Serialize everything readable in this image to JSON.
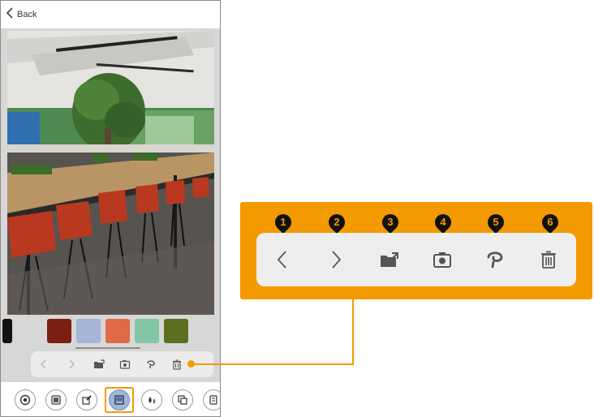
{
  "header": {
    "back_label": "Back",
    "back_icon": "chevron-left-icon"
  },
  "photo": {
    "subject": "office-interior-photo"
  },
  "swatches": [
    {
      "name": "black",
      "color": "#111111"
    },
    {
      "name": "rust-red",
      "color": "#7b1f12"
    },
    {
      "name": "periwinkle",
      "color": "#a6b4d8"
    },
    {
      "name": "orange",
      "color": "#df6a45"
    },
    {
      "name": "mint",
      "color": "#82c6a4"
    },
    {
      "name": "olive",
      "color": "#5a6f20"
    }
  ],
  "toolbar": {
    "buttons": [
      {
        "id": "previous",
        "icon": "chevron-left-icon",
        "callout_number": "1"
      },
      {
        "id": "next",
        "icon": "chevron-right-icon",
        "callout_number": "2"
      },
      {
        "id": "open-folder",
        "icon": "folder-open-icon",
        "callout_number": "3"
      },
      {
        "id": "camera",
        "icon": "camera-icon",
        "callout_number": "4"
      },
      {
        "id": "eyedropper",
        "icon": "lasso-icon",
        "callout_number": "5"
      },
      {
        "id": "delete",
        "icon": "trash-icon",
        "callout_number": "6"
      }
    ]
  },
  "bottom_nav": {
    "items": [
      {
        "icon": "color-wheel-icon"
      },
      {
        "icon": "layers-icon"
      },
      {
        "icon": "edit-image-icon"
      },
      {
        "icon": "image-reference-icon",
        "active": true
      },
      {
        "icon": "drops-icon"
      },
      {
        "icon": "copy-icon"
      },
      {
        "icon": "more-icon"
      }
    ]
  },
  "colors": {
    "accent": "#f39a00",
    "toolbar_bg": "#eeeeee",
    "icon": "#555555"
  }
}
